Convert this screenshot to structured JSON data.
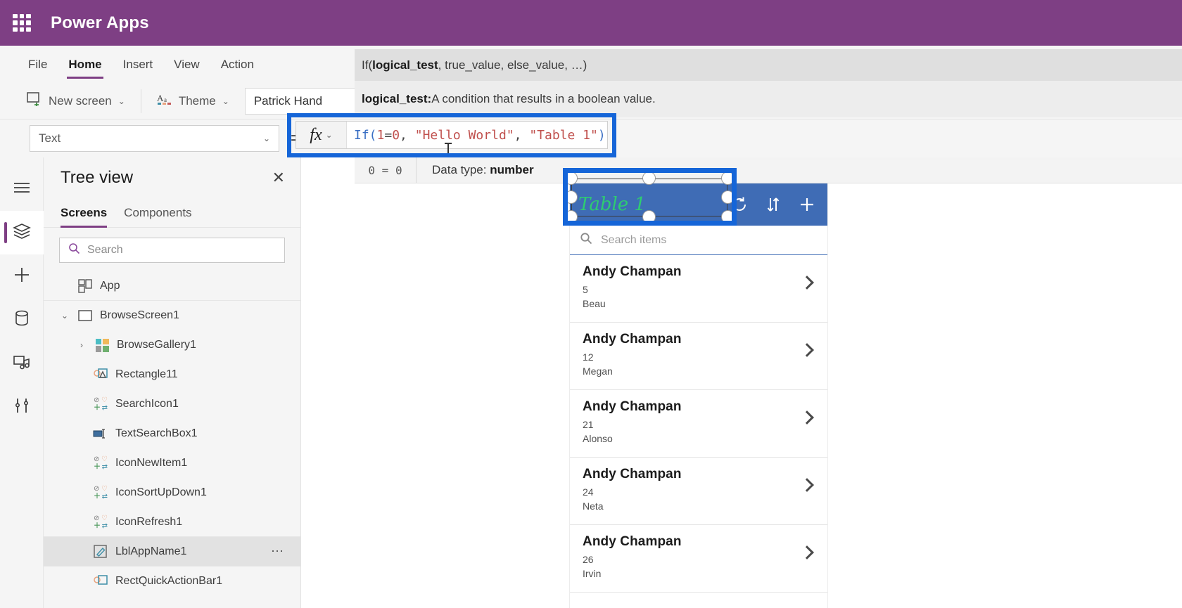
{
  "topbar": {
    "brand": "Power Apps",
    "waffle_icon": "app-launcher-icon"
  },
  "menu": {
    "items": [
      {
        "label": "File",
        "active": false
      },
      {
        "label": "Home",
        "active": true
      },
      {
        "label": "Insert",
        "active": false
      },
      {
        "label": "View",
        "active": false
      },
      {
        "label": "Action",
        "active": false
      }
    ]
  },
  "ribbon": {
    "new_screen_label": "New screen",
    "theme_label": "Theme",
    "font_value": "Patrick Hand"
  },
  "property_row": {
    "selected_property": "Text",
    "equals": "=",
    "fx_label": "fx"
  },
  "formula": {
    "full_text": "If(1=0, \"Hello World\", \"Table 1\")",
    "tokens": [
      {
        "t": "If(",
        "k": "fn"
      },
      {
        "t": "1",
        "k": "num"
      },
      {
        "t": "=",
        "k": "pun"
      },
      {
        "t": "0",
        "k": "num"
      },
      {
        "t": ", ",
        "k": "pun"
      },
      {
        "t": "\"Hello World\"",
        "k": "str"
      },
      {
        "t": ", ",
        "k": "pun"
      },
      {
        "t": "\"Table 1\"",
        "k": "str"
      },
      {
        "t": ")",
        "k": "fn"
      }
    ]
  },
  "intellisense": {
    "signature_prefix": "If(",
    "signature_bold": "logical_test",
    "signature_suffix": ", true_value, else_value, …)",
    "desc_bold": "logical_test:",
    "desc_text": " A condition that results in a boolean value.",
    "eval_result": "0 = 0",
    "datatype_label": "Data type: ",
    "datatype_value": "number"
  },
  "rail": {
    "items": [
      {
        "name": "hamburger-menu",
        "icon": "hamburger-icon",
        "active": false
      },
      {
        "name": "tree-view",
        "icon": "layers-icon",
        "active": true
      },
      {
        "name": "insert",
        "icon": "plus-icon",
        "active": false
      },
      {
        "name": "data",
        "icon": "database-icon",
        "active": false
      },
      {
        "name": "media",
        "icon": "media-icon",
        "active": false
      },
      {
        "name": "advanced-tools",
        "icon": "tools-icon",
        "active": false
      }
    ]
  },
  "treeview": {
    "title": "Tree view",
    "close_icon": "close-icon",
    "tabs": [
      {
        "label": "Screens",
        "active": true
      },
      {
        "label": "Components",
        "active": false
      }
    ],
    "search_placeholder": "Search",
    "search_icon": "search-icon",
    "nodes": [
      {
        "label": "App",
        "icon": "app-icon",
        "indent": 1,
        "twisty": "",
        "selected": false,
        "divider": true,
        "menu": false
      },
      {
        "label": "BrowseScreen1",
        "icon": "screen-icon",
        "indent": 1,
        "twisty": "expanded",
        "selected": false,
        "divider": false,
        "menu": false
      },
      {
        "label": "BrowseGallery1",
        "icon": "gallery-icon",
        "indent": 2,
        "twisty": "collapsed",
        "selected": false,
        "divider": false,
        "menu": false
      },
      {
        "label": "Rectangle11",
        "icon": "shape-icon",
        "indent": 3,
        "twisty": "",
        "selected": false,
        "divider": false,
        "menu": false
      },
      {
        "label": "SearchIcon1",
        "icon": "control-icon",
        "indent": 3,
        "twisty": "",
        "selected": false,
        "divider": false,
        "menu": false
      },
      {
        "label": "TextSearchBox1",
        "icon": "textinput-icon",
        "indent": 3,
        "twisty": "",
        "selected": false,
        "divider": false,
        "menu": false
      },
      {
        "label": "IconNewItem1",
        "icon": "control-icon",
        "indent": 3,
        "twisty": "",
        "selected": false,
        "divider": false,
        "menu": false
      },
      {
        "label": "IconSortUpDown1",
        "icon": "control-icon",
        "indent": 3,
        "twisty": "",
        "selected": false,
        "divider": false,
        "menu": false
      },
      {
        "label": "IconRefresh1",
        "icon": "control-icon",
        "indent": 3,
        "twisty": "",
        "selected": false,
        "divider": false,
        "menu": false
      },
      {
        "label": "LblAppName1",
        "icon": "label-icon",
        "indent": 3,
        "twisty": "",
        "selected": true,
        "divider": false,
        "menu": true
      },
      {
        "label": "RectQuickActionBar1",
        "icon": "shape-icon",
        "indent": 3,
        "twisty": "",
        "selected": false,
        "divider": false,
        "menu": false
      }
    ]
  },
  "canvas": {
    "gallery": {
      "title": "Table 1",
      "title_color": "#2ECC71",
      "header_color": "#3F6CB5",
      "header_icons": [
        {
          "name": "refresh-icon",
          "glyph": "⟳"
        },
        {
          "name": "sort-icon",
          "glyph": "⇅"
        },
        {
          "name": "add-icon",
          "glyph": "+"
        }
      ],
      "search_placeholder": "Search items",
      "search_icon": "search-icon",
      "rows": [
        {
          "title": "Andy Champan",
          "sub1": "5",
          "sub2": "Beau"
        },
        {
          "title": "Andy Champan",
          "sub1": "12",
          "sub2": "Megan"
        },
        {
          "title": "Andy Champan",
          "sub1": "21",
          "sub2": "Alonso"
        },
        {
          "title": "Andy Champan",
          "sub1": "24",
          "sub2": "Neta"
        },
        {
          "title": "Andy Champan",
          "sub1": "26",
          "sub2": "Irvin"
        }
      ],
      "row_arrow_icon": "chevron-right-icon"
    }
  },
  "colors": {
    "brand_purple": "#7E3F84",
    "highlight_blue": "#1565D8",
    "gallery_blue": "#3F6CB5",
    "accent_green": "#2ECC71"
  }
}
